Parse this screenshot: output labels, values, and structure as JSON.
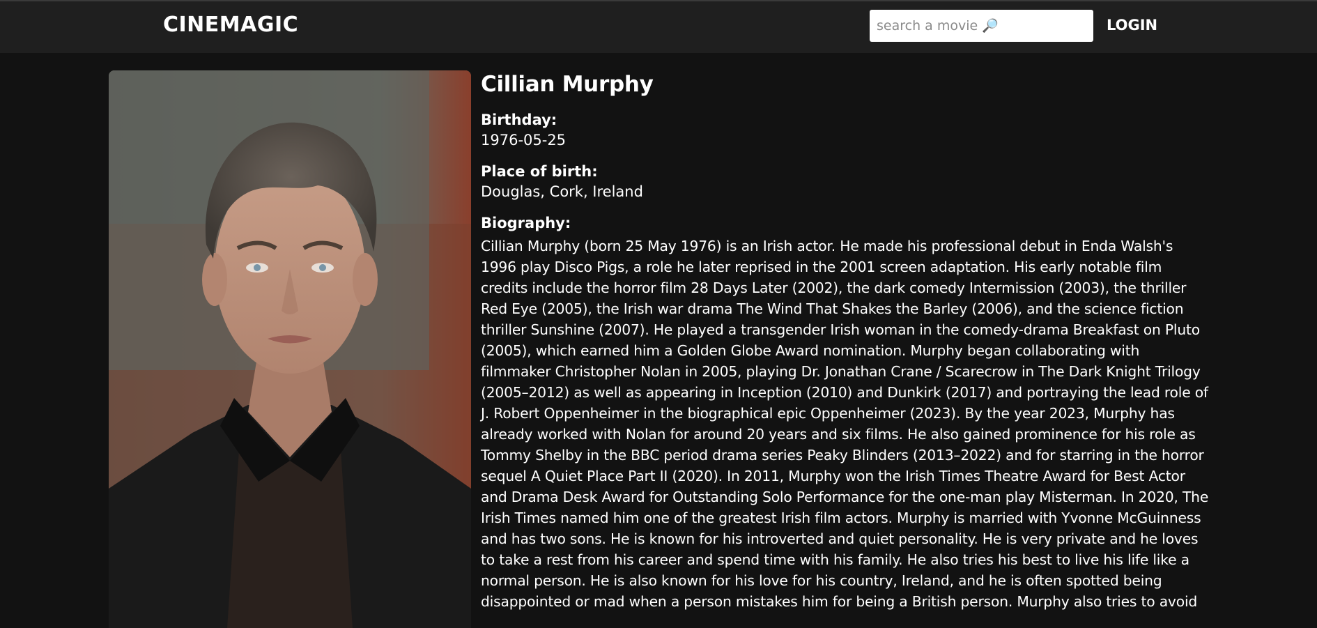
{
  "header": {
    "brand": "CINEMAGIC",
    "search_placeholder": "search a movie 🔎",
    "login_label": "LOGIN"
  },
  "person": {
    "name": "Cillian Murphy",
    "birthday_label": "Birthday:",
    "birthday": "1976-05-25",
    "place_of_birth_label": "Place of birth:",
    "place_of_birth": "Douglas, Cork, Ireland",
    "biography_label": "Biography:",
    "biography": "Cillian Murphy (born 25 May 1976) is an Irish actor. He made his professional debut in Enda Walsh's 1996 play Disco Pigs, a role he later reprised in the 2001 screen adaptation. His early notable film credits include the horror film 28 Days Later (2002), the dark comedy Intermission (2003), the thriller Red Eye (2005), the Irish war drama The Wind That Shakes the Barley (2006), and the science fiction thriller Sunshine (2007). He played a transgender Irish woman in the comedy-drama Breakfast on Pluto (2005), which earned him a Golden Globe Award nomination. Murphy began collaborating with filmmaker Christopher Nolan in 2005, playing Dr. Jonathan Crane / Scarecrow in The Dark Knight Trilogy (2005–2012) as well as appearing in Inception (2010) and Dunkirk (2017) and portraying the lead role of J. Robert Oppenheimer in the biographical epic Oppenheimer (2023). By the year 2023, Murphy has already worked with Nolan for around 20 years and six films. He also gained prominence for his role as Tommy Shelby in the BBC period drama series Peaky Blinders (2013–2022) and for starring in the horror sequel A Quiet Place Part II (2020). In 2011, Murphy won the Irish Times Theatre Award for Best Actor and Drama Desk Award for Outstanding Solo Performance for the one-man play Misterman. In 2020, The Irish Times named him one of the greatest Irish film actors. Murphy is married with Yvonne McGuinness and has two sons. He is known for his introverted and quiet personality. He is very private and he loves to take a rest from his career and spend time with his family. He also tries his best to live his life like a normal person. He is also known for his love for his country, Ireland, and he is often spotted being disappointed or mad when a person mistakes him for being a British person. Murphy also tries to avoid"
  },
  "colors": {
    "background": "#121212",
    "navbar": "#1f1f1f",
    "text": "#ffffff",
    "search_bg": "#ffffff"
  }
}
